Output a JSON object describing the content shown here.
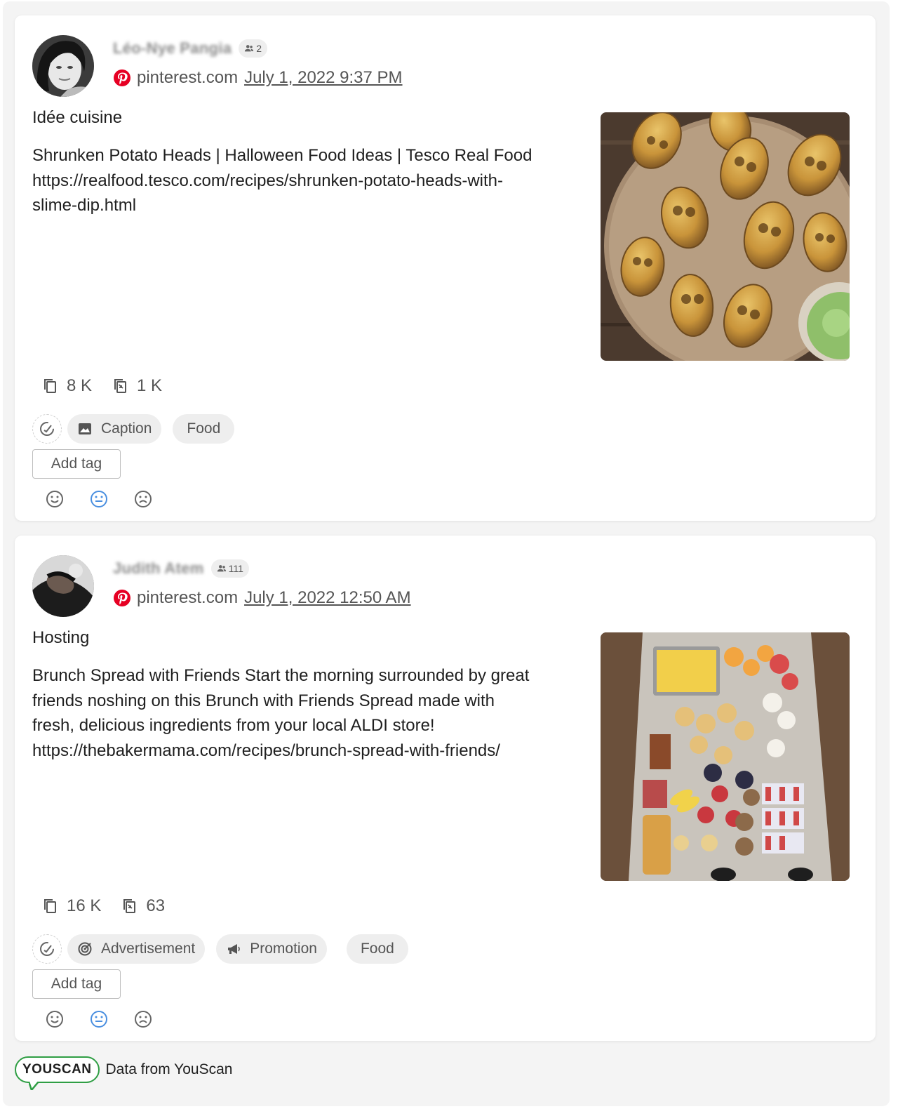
{
  "posts": [
    {
      "author_name": "Léo-Nye Pangia",
      "followers": "2",
      "source_domain": "pinterest.com",
      "date": "July 1, 2022 9:37 PM",
      "title": "Idée cuisine",
      "body": "Shrunken Potato Heads | Halloween Food Ideas | Tesco Real Food\nhttps://realfood.tesco.com/recipes/shrunken-potato-heads-with-\nslime-dip.html",
      "saves": "8 K",
      "repins": "1 K",
      "tags": [
        {
          "label": "Caption",
          "icon": "image-icon"
        },
        {
          "label": "Food",
          "icon": ""
        }
      ],
      "add_tag_label": "Add tag"
    },
    {
      "author_name": "Judith Atem",
      "followers": "111",
      "source_domain": "pinterest.com",
      "date": "July 1, 2022 12:50 AM",
      "title": "Hosting",
      "body": "Brunch Spread with Friends Start the morning surrounded by great\nfriends noshing on this Brunch with Friends Spread made with\nfresh, delicious ingredients from your local ALDI store!\nhttps://thebakermama.com/recipes/brunch-spread-with-friends/",
      "saves": "16 K",
      "repins": "63",
      "tags": [
        {
          "label": "Advertisement",
          "icon": "target-icon"
        },
        {
          "label": "Promotion",
          "icon": "megaphone-icon"
        },
        {
          "label": "Food",
          "icon": ""
        }
      ],
      "add_tag_label": "Add tag"
    }
  ],
  "footer": {
    "logo_text": "YOUSCAN",
    "text": "Data from YouScan"
  },
  "colors": {
    "accent_blue": "#4a8fe0",
    "pinterest_red": "#e60023",
    "youscan_green": "#2f9e44"
  }
}
